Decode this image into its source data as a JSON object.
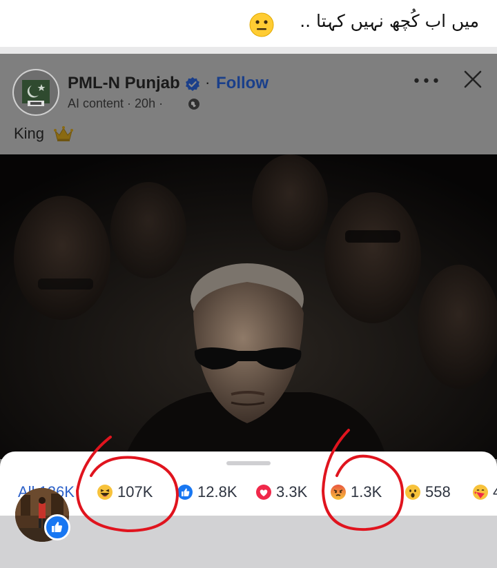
{
  "caption": {
    "text": "میں اب کُچھ نہیں کہتا ..",
    "emoji": "neutral-face-icon"
  },
  "post": {
    "page_name": "PML-N Punjab",
    "follow_label": "Follow",
    "separator": "·",
    "meta_text": "AI content · 20h ·",
    "body_text": "King",
    "body_emoji": "crown-icon",
    "more_label": "•••"
  },
  "reactions": {
    "all_label": "All 126K",
    "items": [
      {
        "emoji": "laughing-face-icon",
        "count": "107K"
      },
      {
        "emoji": "like-icon",
        "count": "12.8K"
      },
      {
        "emoji": "love-icon",
        "count": "3.3K"
      },
      {
        "emoji": "angry-face-icon",
        "count": "1.3K"
      },
      {
        "emoji": "wow-face-icon",
        "count": "558"
      },
      {
        "emoji": "care-face-icon",
        "count": "4"
      }
    ]
  },
  "colors": {
    "facebook_blue": "#1877f2",
    "follow_blue": "#1a3f8a",
    "annotation_red": "#e0141e",
    "dim_overlay": "#7f7f7f"
  }
}
